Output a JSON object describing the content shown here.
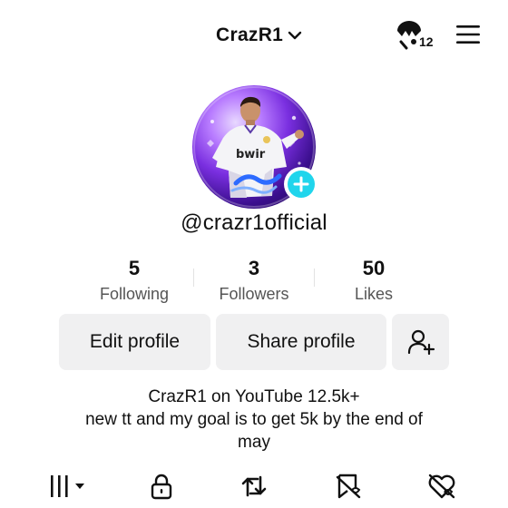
{
  "header": {
    "account_name": "CrazR1",
    "notifications_count": "12",
    "icons": {
      "switch": "chevron-down-icon",
      "notifications": "notification-icon",
      "menu": "menu-icon"
    }
  },
  "profile": {
    "username": "@crazr1official",
    "avatar_icon": "profile-photo",
    "add_icon": "plus-icon",
    "accent_color": "#20d5ec"
  },
  "stats": [
    {
      "value": "5",
      "label": "Following"
    },
    {
      "value": "3",
      "label": "Followers"
    },
    {
      "value": "50",
      "label": "Likes"
    }
  ],
  "actions": {
    "edit_profile": "Edit profile",
    "share_profile": "Share profile",
    "add_friend_icon": "add-user-icon"
  },
  "bio": {
    "line1": "CrazR1 on YouTube 12.5k+",
    "line2": "new tt and my goal is to get 5k by the end of",
    "line3": "may"
  },
  "tabs": [
    {
      "icon": "grid-icon"
    },
    {
      "icon": "lock-icon"
    },
    {
      "icon": "repost-icon"
    },
    {
      "icon": "favorites-icon"
    },
    {
      "icon": "liked-icon"
    }
  ]
}
